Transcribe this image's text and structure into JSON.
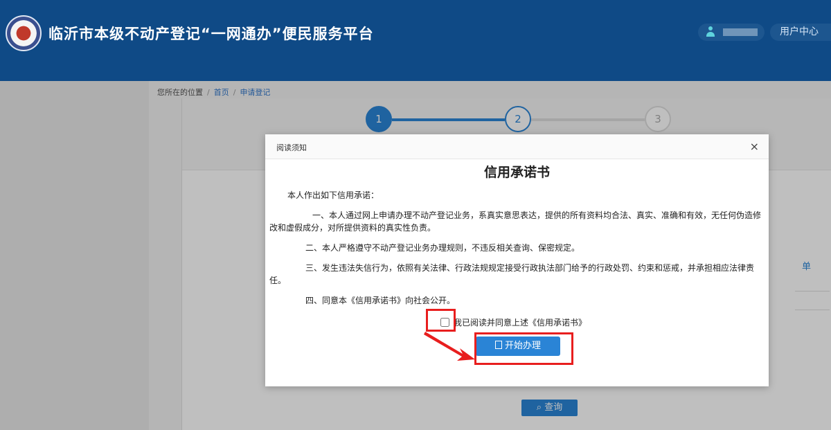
{
  "header": {
    "title": "临沂市本级不动产登记“一网通办”便民服务平台",
    "user_center": "用户中心"
  },
  "breadcrumb": {
    "label": "您所在的位置",
    "home": "首页",
    "current": "申请登记"
  },
  "steps": [
    "1",
    "2",
    "3"
  ],
  "page": {
    "query_button": "查询",
    "side_link": "单"
  },
  "modal": {
    "title": "阅读须知",
    "close": "×",
    "doc_title": "信用承诺书",
    "intro": "本人作出如下信用承诺：",
    "items": [
      "一、本人通过网上申请办理不动产登记业务，系真实意思表达，提供的所有资料均合法、真实、准确和有效，无任何伪造修改和虚假成分，对所提供资料的真实性负责。",
      "二、本人严格遵守不动产登记业务办理规则，不违反相关查询、保密规定。",
      "三、发生违法失信行为，依照有关法律、行政法规规定接受行政执法部门给予的行政处罚、约束和惩戒，并承担相应法律责任。",
      "四、同意本《信用承诺书》向社会公开。"
    ],
    "agree_label": "我已阅读并同意上述《信用承诺书》",
    "start_button": "开始办理"
  },
  "colors": {
    "header_bg": "#0f4a86",
    "primary": "#2a84d6",
    "highlight": "#e81e1e"
  }
}
